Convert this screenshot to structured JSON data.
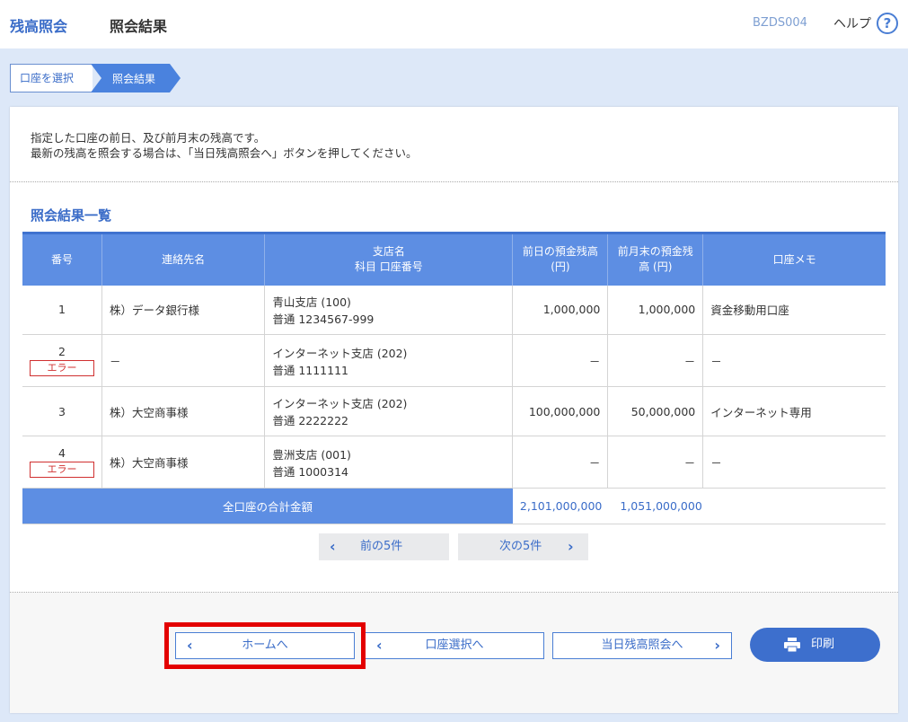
{
  "header": {
    "app_title": "残高照会",
    "page_title": "照会結果",
    "screen_code": "BZDS004",
    "help_label": "ヘルプ",
    "help_icon": "?"
  },
  "breadcrumb": {
    "step1": "口座を選択",
    "step2": "照会結果"
  },
  "intro": {
    "line1": "指定した口座の前日、及び前月末の残高です。",
    "line2": "最新の残高を照会する場合は、「当日残高照会へ」ボタンを押してください。"
  },
  "section_title": "照会結果一覧",
  "table": {
    "headers": {
      "no": "番号",
      "contact": "連絡先名",
      "branch_line1": "支店名",
      "branch_line2": "科目 口座番号",
      "prev_day_line1": "前日の預金残高",
      "prev_day_line2": "(円)",
      "prev_month_line1": "前月末の預金残",
      "prev_month_line2": "高 (円)",
      "memo": "口座メモ"
    },
    "rows": [
      {
        "no": "1",
        "error": "",
        "contact": "株）データ銀行様",
        "branch": "青山支店 (100)",
        "account": "普通 1234567-999",
        "prev_day": "1,000,000",
        "prev_month": "1,000,000",
        "memo": "資金移動用口座"
      },
      {
        "no": "2",
        "error": "エラー",
        "contact": "－",
        "branch": "インターネット支店 (202)",
        "account": "普通 1111111",
        "prev_day": "－",
        "prev_month": "－",
        "memo": "－"
      },
      {
        "no": "3",
        "error": "",
        "contact": "株）大空商事様",
        "branch": "インターネット支店 (202)",
        "account": "普通 2222222",
        "prev_day": "100,000,000",
        "prev_month": "50,000,000",
        "memo": "インターネット専用"
      },
      {
        "no": "4",
        "error": "エラー",
        "contact": "株）大空商事様",
        "branch": "豊洲支店 (001)",
        "account": "普通 1000314",
        "prev_day": "－",
        "prev_month": "－",
        "memo": "－"
      }
    ],
    "total_label": "全口座の合計金額",
    "total_prev_day": "2,101,000,000",
    "total_prev_month": "1,051,000,000"
  },
  "pagination": {
    "prev_label": "前の5件",
    "next_label": "次の5件"
  },
  "buttons": {
    "home": "ホームへ",
    "back": "口座選択へ",
    "today": "当日残高照会へ",
    "print": "印刷"
  },
  "colors": {
    "accent": "#3a6cc8",
    "table_header": "#5d8ee3",
    "error": "#d03030",
    "highlight": "#e30000"
  }
}
